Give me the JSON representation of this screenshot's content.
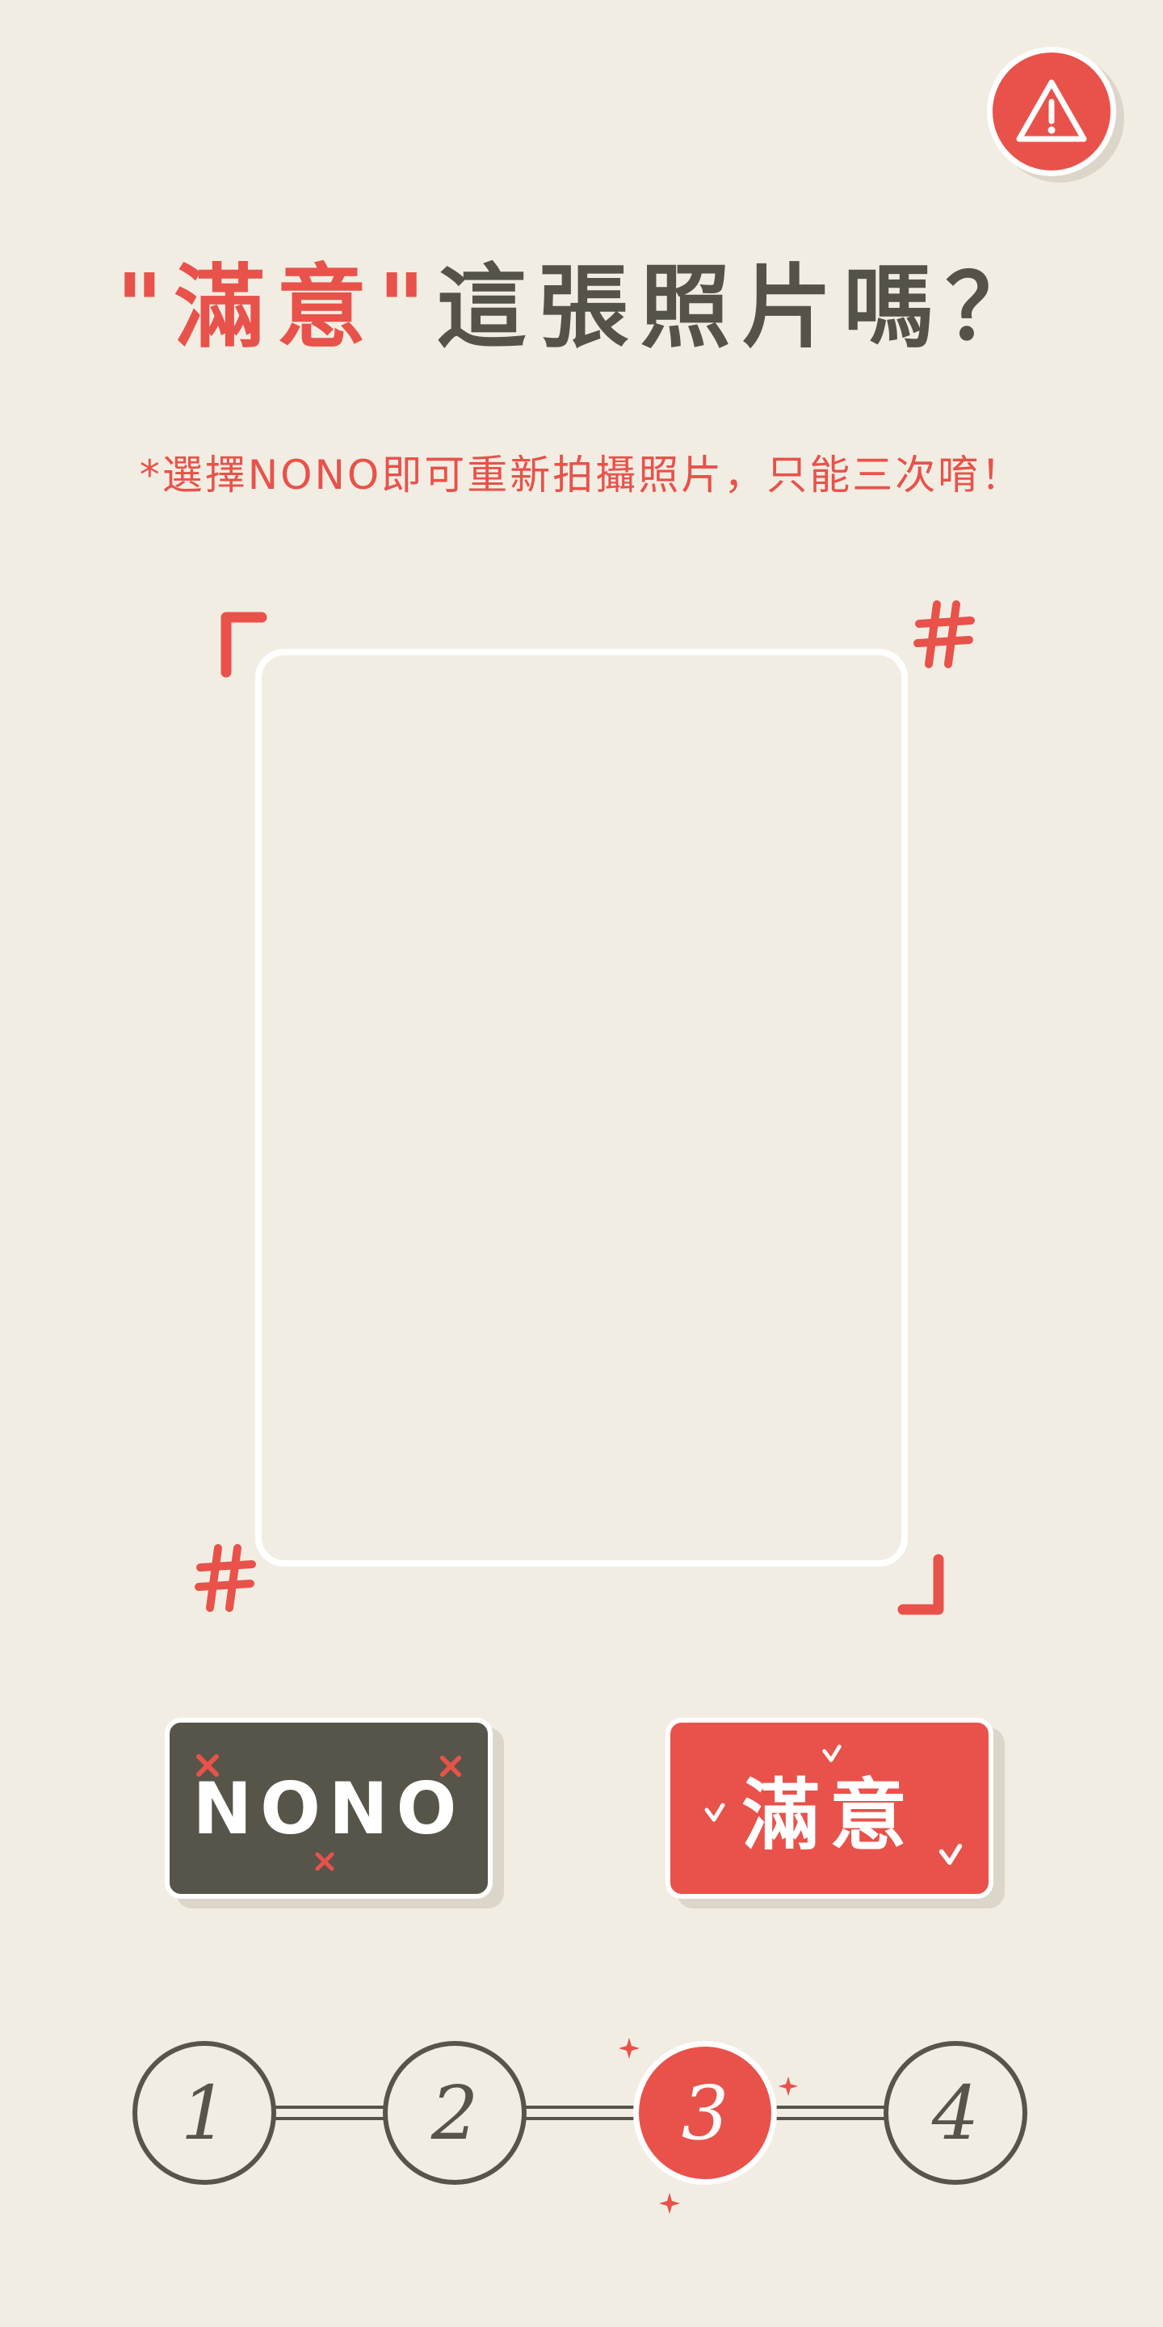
{
  "header": {
    "title_quote_open": "\"",
    "title_accent": "滿意",
    "title_quote_close": "\"",
    "title_rest": "這張照片嗎？"
  },
  "subtitle": "*選擇NONO即可重新拍攝照片，只能三次唷！",
  "buttons": {
    "nono_label": "NONO",
    "ok_label": "滿意"
  },
  "steps": [
    {
      "label": "1",
      "active": false
    },
    {
      "label": "2",
      "active": false
    },
    {
      "label": "3",
      "active": true
    },
    {
      "label": "4",
      "active": false
    }
  ],
  "icons": {
    "warning": "warning-triangle-icon"
  },
  "colors": {
    "accent": "#e8524a",
    "dark": "#57544a",
    "background": "#f2ede3"
  }
}
